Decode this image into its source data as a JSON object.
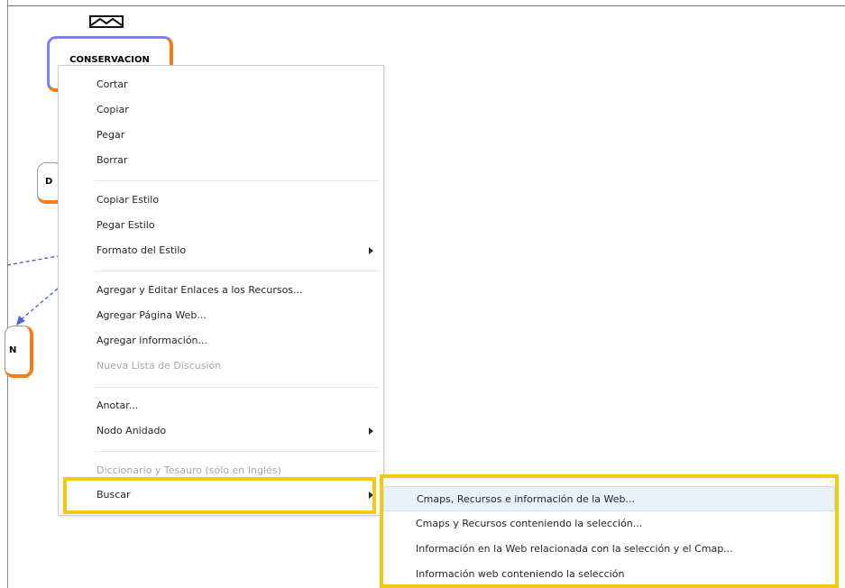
{
  "nodes": {
    "conservacion": "CONSERVACIÓN",
    "partial_d": "D",
    "partial_n": "N"
  },
  "context_menu": {
    "items": [
      {
        "label": "Cortar"
      },
      {
        "label": "Copiar"
      },
      {
        "label": "Pegar"
      },
      {
        "label": "Borrar"
      },
      {
        "label": "Copiar Estilo"
      },
      {
        "label": "Pegar Estilo"
      },
      {
        "label": "Formato del Estilo"
      },
      {
        "label": "Agregar y Editar Enlaces a los Recursos..."
      },
      {
        "label": "Agregar Página Web..."
      },
      {
        "label": "Agregar información..."
      },
      {
        "label": "Nueva Lista de Discusión"
      },
      {
        "label": "Anotar..."
      },
      {
        "label": "Nodo Anidado"
      },
      {
        "label": "Diccionario y Tesauro (sólo en Inglés)"
      },
      {
        "label": "Buscar"
      }
    ]
  },
  "submenu": {
    "items": [
      {
        "label": "Cmaps, Recursos e información de la Web..."
      },
      {
        "label": "Cmaps y Recursos conteniendo la selección..."
      },
      {
        "label": "Información en la Web relacionada con la selección y el Cmap..."
      },
      {
        "label": "Información web conteniendo la selección"
      }
    ]
  },
  "colors": {
    "highlight": "#f2ca14",
    "node_border": "#f97a12",
    "selection_blue": "#7e82e8"
  }
}
